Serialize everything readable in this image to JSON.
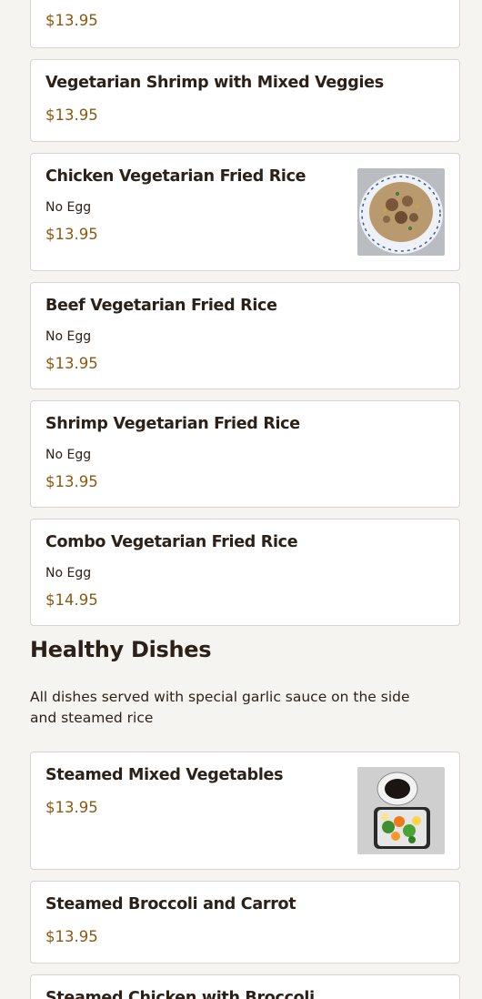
{
  "items_top": [
    {
      "name": "",
      "note": "",
      "price": "$13.95"
    },
    {
      "name": "Vegetarian Shrimp with Mixed Veggies",
      "price": "$13.95"
    },
    {
      "name": "Chicken Vegetarian Fried Rice",
      "note": "No Egg",
      "price": "$13.95",
      "image": "fried-rice-photo"
    },
    {
      "name": "Beef Vegetarian Fried Rice",
      "note": "No Egg",
      "price": "$13.95"
    },
    {
      "name": "Shrimp Vegetarian Fried Rice",
      "note": "No Egg",
      "price": "$13.95"
    },
    {
      "name": "Combo Vegetarian Fried Rice",
      "note": "No Egg",
      "price": "$14.95"
    }
  ],
  "section": {
    "title": "Healthy Dishes",
    "description": "All dishes served with special garlic sauce on the side and steamed rice"
  },
  "items_healthy": [
    {
      "name": "Steamed Mixed Vegetables",
      "price": "$13.95",
      "image": "steamed-vegetables-photo"
    },
    {
      "name": "Steamed Broccoli and Carrot",
      "price": "$13.95"
    },
    {
      "name": "Steamed Chicken with Broccoli",
      "price": ""
    }
  ],
  "colors": {
    "price": "#8a5a14",
    "text": "#2b2118",
    "card_border": "#d9d4cf",
    "background": "#f6f4f1"
  }
}
